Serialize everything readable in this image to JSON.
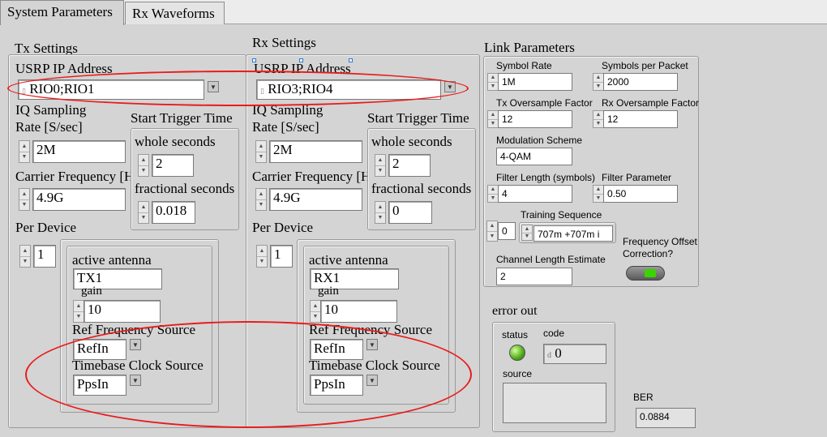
{
  "tabs": [
    {
      "label": "System Parameters"
    },
    {
      "label": "Rx Waveforms"
    }
  ],
  "tx": {
    "title": "Tx Settings",
    "usrp_label": "USRP IP Address",
    "usrp_value": "RIO0;RIO1",
    "iq_label_1": "IQ Sampling",
    "iq_label_2": "Rate [S/sec]",
    "iq_value": "2M",
    "start_trigger_label": "Start Trigger Time",
    "whole_seconds_label": "whole seconds",
    "whole_seconds_value": "2",
    "fractional_seconds_label": "fractional seconds",
    "fractional_seconds_value": "0.018",
    "carrier_label": "Carrier Frequency [H",
    "carrier_value": "4.9G",
    "per_device_label": "Per Device",
    "index_value": "1",
    "antenna_label": "active antenna",
    "antenna_value": "TX1",
    "gain_label": "gain",
    "gain_value": "10",
    "ref_freq_label": "Ref Frequency Source",
    "ref_freq_value": "RefIn",
    "timebase_label": "Timebase Clock Source",
    "timebase_value": "PpsIn"
  },
  "rx": {
    "title": "Rx Settings",
    "usrp_label": "USRP IP Address",
    "usrp_value": "RIO3;RIO4",
    "iq_label_1": "IQ Sampling",
    "iq_label_2": "Rate [S/sec]",
    "iq_value": "2M",
    "start_trigger_label": "Start Trigger Time",
    "whole_seconds_label": "whole seconds",
    "whole_seconds_value": "2",
    "fractional_seconds_label": "fractional seconds",
    "fractional_seconds_value": "0",
    "carrier_label": "Carrier Frequency [H",
    "carrier_value": "4.9G",
    "per_device_label": "Per Device",
    "index_value": "1",
    "antenna_label": "active antenna",
    "antenna_value": "RX1",
    "gain_label": "gain",
    "gain_value": "10",
    "ref_freq_label": "Ref Frequency Source",
    "ref_freq_value": "RefIn",
    "timebase_label": "Timebase Clock Source",
    "timebase_value": "PpsIn"
  },
  "link": {
    "title": "Link Parameters",
    "symbol_rate_label": "Symbol Rate",
    "symbol_rate_value": "1M",
    "symbols_per_packet_label": "Symbols per Packet",
    "symbols_per_packet_value": "2000",
    "tx_oversample_label": "Tx Oversample Factor",
    "tx_oversample_value": "12",
    "rx_oversample_label": "Rx Oversample Factor",
    "rx_oversample_value": "12",
    "modulation_label": "Modulation Scheme",
    "modulation_value": "4-QAM",
    "filter_length_label": "Filter Length (symbols)",
    "filter_length_value": "4",
    "filter_param_label": "Filter Parameter",
    "filter_param_value": "0.50",
    "training_index_value": "0",
    "training_label": "Training Sequence",
    "training_value": "707m +707m i",
    "freq_offset_label_1": "Frequency Offset",
    "freq_offset_label_2": "Correction?",
    "channel_length_label": "Channel Length Estimate",
    "channel_length_value": "2"
  },
  "error_out": {
    "title": "error out",
    "status_label": "status",
    "code_label": "code",
    "code_prefix": "d",
    "code_value": "0",
    "source_label": "source",
    "source_value": ""
  },
  "ber": {
    "label": "BER",
    "value": "0.0884"
  },
  "icons": {
    "spinner": "up-down-arrows",
    "dropdown": "down-triangle",
    "status_led": "green-led"
  },
  "colors": {
    "annotation": "#e81c1c",
    "led_on": "#4caa16",
    "panel_bg": "#d4d4d4"
  }
}
